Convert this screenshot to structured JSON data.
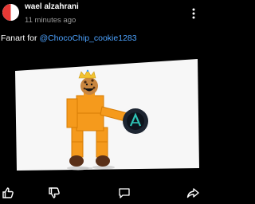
{
  "post": {
    "author": "wael alzahrani",
    "timestamp": "11 minutes ago",
    "caption_prefix": "Fanart for ",
    "caption_mention": "@ChocoChip_cookie1283"
  },
  "icons": {
    "menu": "more-vertical-icon",
    "like": "thumbs-up-icon",
    "dislike": "thumbs-down-icon",
    "comment": "comment-icon",
    "share": "share-icon"
  },
  "colors": {
    "background": "#000000",
    "mention": "#4da3ff",
    "avatar_accent": "#e53935"
  }
}
